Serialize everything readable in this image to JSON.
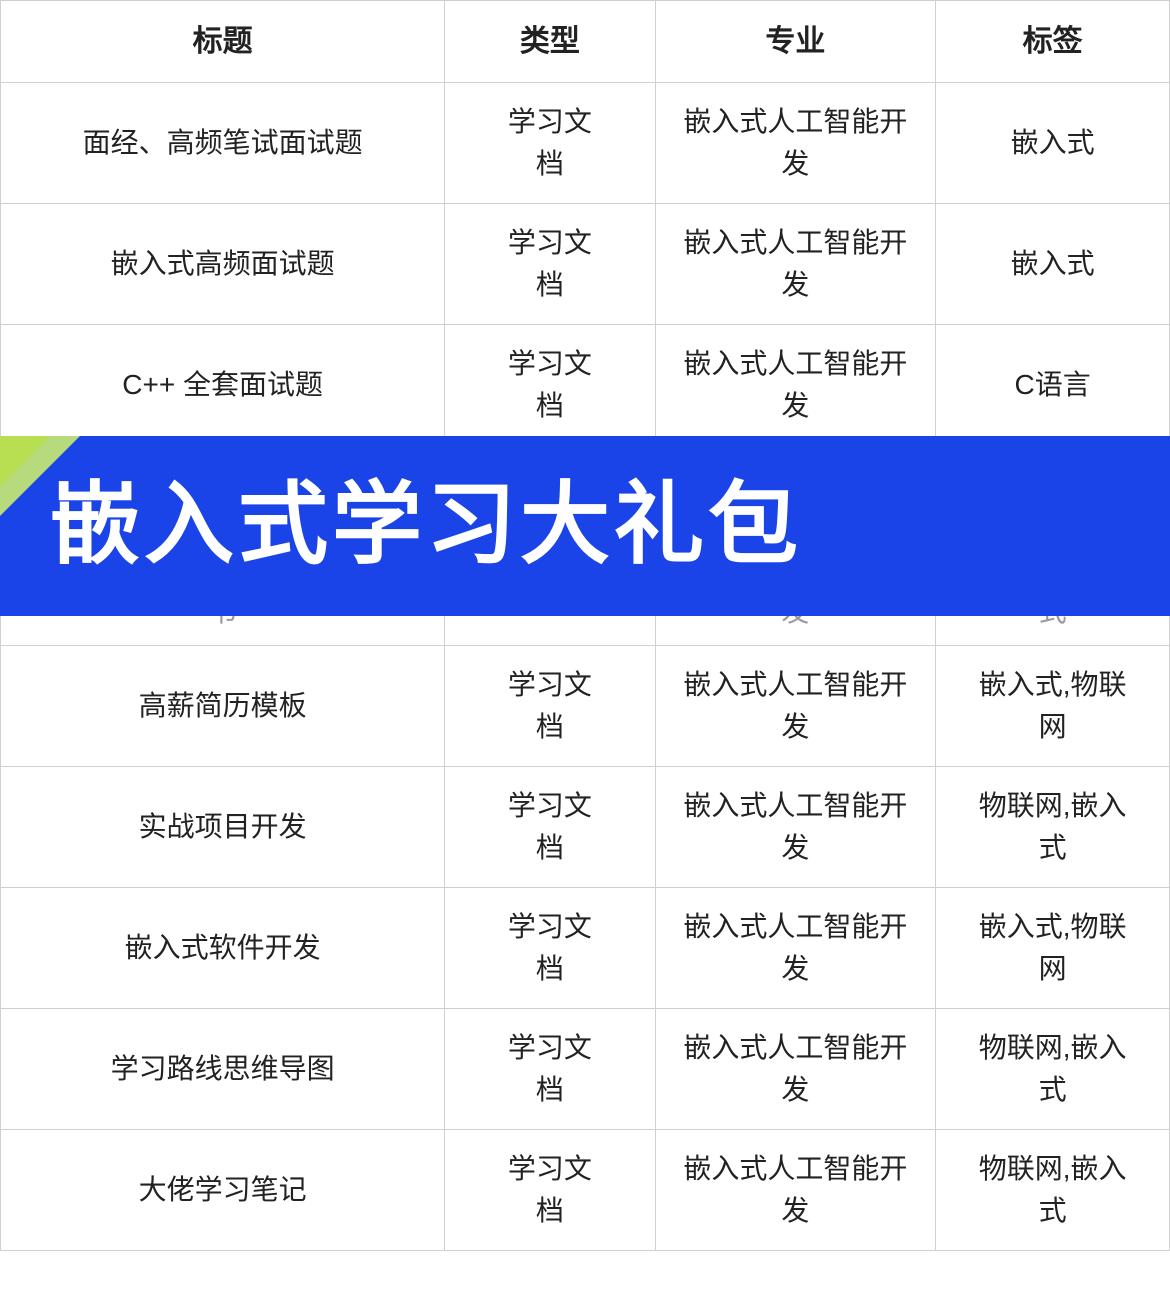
{
  "table": {
    "headers": [
      "标题",
      "类型",
      "专业",
      "标签"
    ],
    "rows": [
      {
        "title": "面经、高频笔试面试题",
        "type": "学习文\n档",
        "major": "嵌入式人工智能开\n发",
        "tag": "嵌入式"
      },
      {
        "title": "嵌入式高频面试题",
        "type": "学习文\n档",
        "major": "嵌入式人工智能开\n发",
        "tag": "嵌入式"
      },
      {
        "title": "C++ 全套面试题",
        "type": "学习文\n档",
        "major": "嵌入式人工智能开\n发",
        "tag": "C语言"
      },
      {
        "title_partial": "书",
        "major_partial": "发",
        "tag_partial": "式"
      },
      {
        "title": "高薪简历模板",
        "type": "学习文\n档",
        "major": "嵌入式人工智能开\n发",
        "tag": "嵌入式,物联\n网"
      },
      {
        "title": "实战项目开发",
        "type": "学习文\n档",
        "major": "嵌入式人工智能开\n发",
        "tag": "物联网,嵌入\n式"
      },
      {
        "title": "嵌入式软件开发",
        "type": "学习文\n档",
        "major": "嵌入式人工智能开\n发",
        "tag": "嵌入式,物联\n网"
      },
      {
        "title": "学习路线思维导图",
        "type": "学习文\n档",
        "major": "嵌入式人工智能开\n发",
        "tag": "物联网,嵌入\n式"
      },
      {
        "title": "大佬学习笔记",
        "type": "学习文\n档",
        "major": "嵌入式人工智能开\n发",
        "tag": "物联网,嵌入\n式"
      }
    ],
    "banner": {
      "text": "嵌入式学习大礼包",
      "bg_color": "#1a44e8",
      "text_color": "#ffffff"
    }
  }
}
